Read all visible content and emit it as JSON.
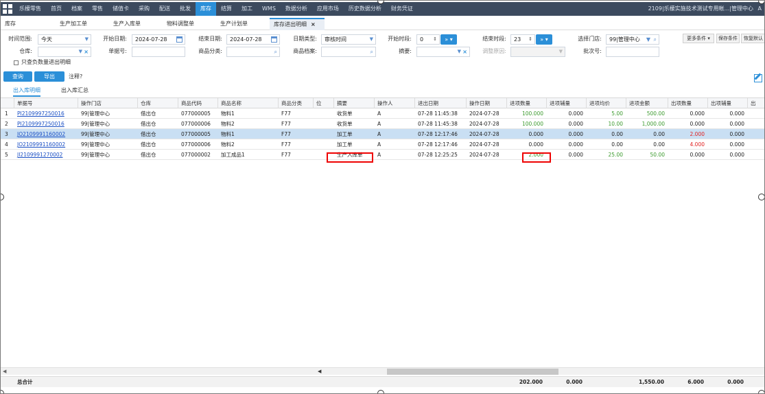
{
  "nav": {
    "items": [
      "乐檬零售",
      "首页",
      "档案",
      "零售",
      "储值卡",
      "采购",
      "配送",
      "批发",
      "库存",
      "结算",
      "加工",
      "WMS",
      "数据分析",
      "应用市场",
      "历史数据分析",
      "财务凭证"
    ],
    "active_index": 8,
    "right_text": "2109|乐檬实施技术测试专用帐...|管理中心",
    "user": "A",
    "menu_icon": "grid-icon"
  },
  "tabs": {
    "items": [
      "库存",
      "生产加工单",
      "生产入库单",
      "物料调整单",
      "生产计划单",
      "库存进出明细"
    ],
    "active_index": 5,
    "close": "×"
  },
  "filters": {
    "time_range_label": "时间范围:",
    "time_range_value": "今天",
    "start_date_label": "开始日期:",
    "start_date_value": "2024-07-28",
    "end_date_label": "结束日期:",
    "end_date_value": "2024-07-28",
    "date_type_label": "日期类型:",
    "date_type_value": "审核时间",
    "start_hour_label": "开始时段:",
    "start_hour_value": "0",
    "end_hour_label": "结束时段:",
    "end_hour_value": "23",
    "hour_btn": "»",
    "store_label": "选择门店:",
    "store_value": "99|管理中心",
    "more_conditions": "更多条件",
    "save_conditions": "保存条件",
    "restore_default": "恢复默认",
    "warehouse_label": "仓库:",
    "doc_no_label": "单据号:",
    "category_label": "商品分类:",
    "product_label": "商品档案:",
    "summary_label": "摘要:",
    "adjust_reason_label": "调整原因:",
    "batch_label": "批次号:",
    "only_negative_label": "只查负数量进出明细",
    "query_btn": "查询",
    "export_btn": "导出",
    "note_label": "注释?"
  },
  "subtabs": [
    "出入库明细",
    "出入库汇总"
  ],
  "grid": {
    "columns": [
      "",
      "单据号",
      "操作门店",
      "仓库",
      "商品代码",
      "商品名称",
      "商品分类",
      "位",
      "摘要",
      "操作人",
      "进出日期",
      "操作日期",
      "进项数量",
      "进项辅量",
      "进项均价",
      "进项金额",
      "出项数量",
      "出项辅量",
      "出"
    ],
    "rows": [
      {
        "idx": "1",
        "doc": "PI2109997250016",
        "store": "99|管理中心",
        "wh": "借出仓",
        "code": "077000005",
        "name": "物料1",
        "cat": "F77",
        "summary": "收货单",
        "op": "A",
        "io_date": "07-28 11:45:38",
        "op_date": "2024-07-28",
        "in_qty": "100.000",
        "in_aux": "0.000",
        "in_price": "5.00",
        "in_amt": "500.00",
        "out_qty": "0.000",
        "out_aux": "0.000"
      },
      {
        "idx": "2",
        "doc": "PI2109997250016",
        "store": "99|管理中心",
        "wh": "借出仓",
        "code": "077000006",
        "name": "物料2",
        "cat": "F77",
        "summary": "收货单",
        "op": "A",
        "io_date": "07-28 11:45:38",
        "op_date": "2024-07-28",
        "in_qty": "100.000",
        "in_aux": "0.000",
        "in_price": "10.00",
        "in_amt": "1,000.00",
        "out_qty": "0.000",
        "out_aux": "0.000"
      },
      {
        "idx": "3",
        "doc": "JO2109991160002",
        "store": "99|管理中心",
        "wh": "借出仓",
        "code": "077000005",
        "name": "物料1",
        "cat": "F77",
        "summary": "加工单",
        "op": "A",
        "io_date": "07-28 12:17:46",
        "op_date": "2024-07-28",
        "in_qty": "0.000",
        "in_aux": "0.000",
        "in_price": "0.00",
        "in_amt": "0.00",
        "out_qty": "2.000",
        "out_aux": "0.000"
      },
      {
        "idx": "4",
        "doc": "JO2109991160002",
        "store": "99|管理中心",
        "wh": "借出仓",
        "code": "077000006",
        "name": "物料2",
        "cat": "F77",
        "summary": "加工单",
        "op": "A",
        "io_date": "07-28 12:17:46",
        "op_date": "2024-07-28",
        "in_qty": "0.000",
        "in_aux": "0.000",
        "in_price": "0.00",
        "in_amt": "0.00",
        "out_qty": "4.000",
        "out_aux": "0.000"
      },
      {
        "idx": "5",
        "doc": "JI2109991270002",
        "store": "99|管理中心",
        "wh": "借出仓",
        "code": "077000002",
        "name": "加工成品1",
        "cat": "F77",
        "summary": "生产入库单",
        "op": "A",
        "io_date": "07-28 12:25:25",
        "op_date": "2024-07-28",
        "in_qty": "2.000",
        "in_aux": "0.000",
        "in_price": "25.00",
        "in_amt": "50.00",
        "out_qty": "0.000",
        "out_aux": "0.000"
      }
    ]
  },
  "totals": {
    "label": "总合计",
    "in_qty": "202.000",
    "in_aux": "0.000",
    "in_amt": "1,550.00",
    "out_qty": "6.000",
    "out_aux": "0.000"
  },
  "colors": {
    "accent": "#2b8fd8",
    "nav_bg": "#3c4a5e",
    "green": "#3a9a2c",
    "red": "#e02020",
    "selected_row": "#c9dff3"
  }
}
